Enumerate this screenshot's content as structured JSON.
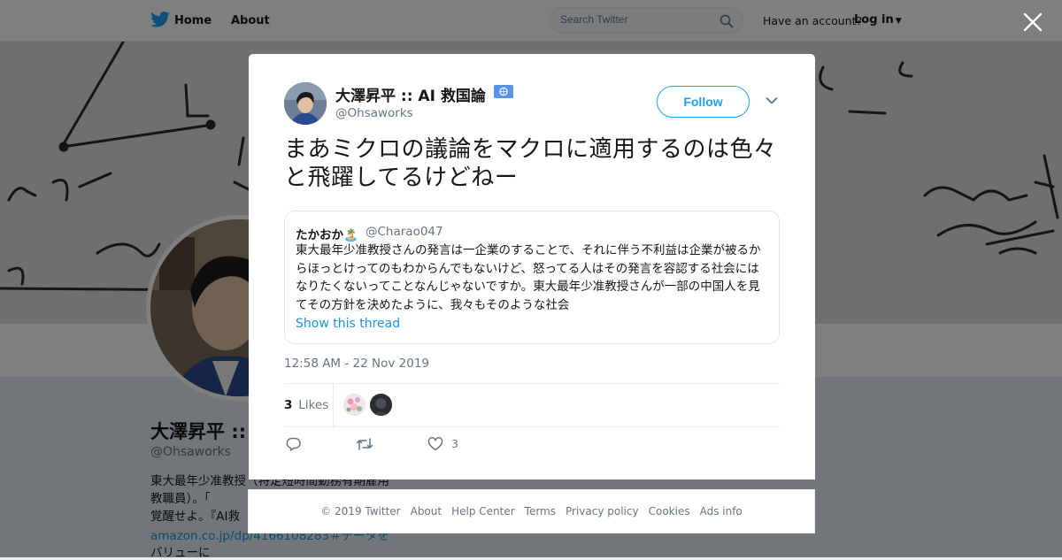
{
  "topbar": {
    "home_label": "Home",
    "about_label": "About",
    "search_placeholder": "Search Twitter",
    "have_account": "Have an account?",
    "login_label": "Log in"
  },
  "profile": {
    "name": "大澤昇平 :: ",
    "handle": "@Ohsaworks",
    "bio": "東大最年少准教授（特定短時間勤務有期雇用教職員）。「",
    "bio_line3": "覚醒せよ。『AI救",
    "link": "amazon.co.jp/dp/4166108283",
    "link_suffix": "＃データを",
    "bio_line5": "バリューに"
  },
  "tweet": {
    "author_name": "大澤昇平 :: AI 救国論",
    "author_handle": "@Ohsaworks",
    "follow_label": "Follow",
    "text": "まあミクロの議論をマクロに適用するのは色々と飛躍してるけどねー",
    "quoted": {
      "name": "たかおか🏝️",
      "handle": "@Charao047",
      "text": "東大最年少准教授さんの発言は一企業のすることで、それに伴う不利益は企業が被るからほっとけってのもわからんでもないけど、怒ってる人はその発言を容認する社会にはなりたくないってことなんじゃないですか。東大最年少准教授さんが一部の中国人を見てその方針を決めたように、我々もそのような社会",
      "show_thread": "Show this thread"
    },
    "timestamp": "12:58 AM - 22 Nov 2019",
    "likes_count": "3",
    "likes_label": "Likes",
    "like_action_count": "3"
  },
  "footer": {
    "links": [
      "© 2019 Twitter",
      "About",
      "Help Center",
      "Terms",
      "Privacy policy",
      "Cookies",
      "Ads info"
    ]
  },
  "colors": {
    "accent": "#1da1f2",
    "link": "#1b95e0",
    "secondary_text": "#657786"
  },
  "icons": [
    "twitter-bird-icon",
    "search-icon",
    "close-icon",
    "chevron-down-icon",
    "reply-icon",
    "retweet-icon",
    "heart-icon",
    "un-flag-icon"
  ]
}
